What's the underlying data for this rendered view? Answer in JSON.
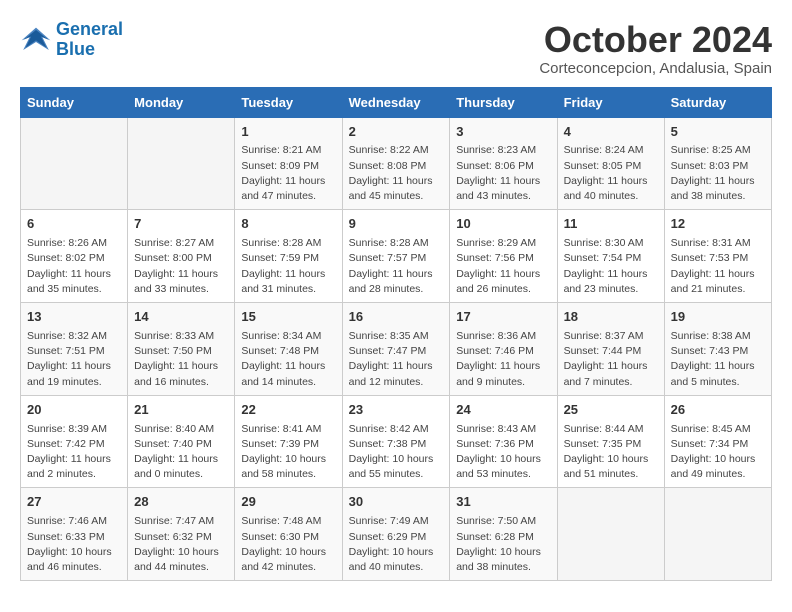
{
  "logo": {
    "line1": "General",
    "line2": "Blue"
  },
  "title": "October 2024",
  "location": "Corteconcepcion, Andalusia, Spain",
  "header_days": [
    "Sunday",
    "Monday",
    "Tuesday",
    "Wednesday",
    "Thursday",
    "Friday",
    "Saturday"
  ],
  "weeks": [
    [
      {
        "day": "",
        "info": ""
      },
      {
        "day": "",
        "info": ""
      },
      {
        "day": "1",
        "info": "Sunrise: 8:21 AM\nSunset: 8:09 PM\nDaylight: 11 hours and 47 minutes."
      },
      {
        "day": "2",
        "info": "Sunrise: 8:22 AM\nSunset: 8:08 PM\nDaylight: 11 hours and 45 minutes."
      },
      {
        "day": "3",
        "info": "Sunrise: 8:23 AM\nSunset: 8:06 PM\nDaylight: 11 hours and 43 minutes."
      },
      {
        "day": "4",
        "info": "Sunrise: 8:24 AM\nSunset: 8:05 PM\nDaylight: 11 hours and 40 minutes."
      },
      {
        "day": "5",
        "info": "Sunrise: 8:25 AM\nSunset: 8:03 PM\nDaylight: 11 hours and 38 minutes."
      }
    ],
    [
      {
        "day": "6",
        "info": "Sunrise: 8:26 AM\nSunset: 8:02 PM\nDaylight: 11 hours and 35 minutes."
      },
      {
        "day": "7",
        "info": "Sunrise: 8:27 AM\nSunset: 8:00 PM\nDaylight: 11 hours and 33 minutes."
      },
      {
        "day": "8",
        "info": "Sunrise: 8:28 AM\nSunset: 7:59 PM\nDaylight: 11 hours and 31 minutes."
      },
      {
        "day": "9",
        "info": "Sunrise: 8:28 AM\nSunset: 7:57 PM\nDaylight: 11 hours and 28 minutes."
      },
      {
        "day": "10",
        "info": "Sunrise: 8:29 AM\nSunset: 7:56 PM\nDaylight: 11 hours and 26 minutes."
      },
      {
        "day": "11",
        "info": "Sunrise: 8:30 AM\nSunset: 7:54 PM\nDaylight: 11 hours and 23 minutes."
      },
      {
        "day": "12",
        "info": "Sunrise: 8:31 AM\nSunset: 7:53 PM\nDaylight: 11 hours and 21 minutes."
      }
    ],
    [
      {
        "day": "13",
        "info": "Sunrise: 8:32 AM\nSunset: 7:51 PM\nDaylight: 11 hours and 19 minutes."
      },
      {
        "day": "14",
        "info": "Sunrise: 8:33 AM\nSunset: 7:50 PM\nDaylight: 11 hours and 16 minutes."
      },
      {
        "day": "15",
        "info": "Sunrise: 8:34 AM\nSunset: 7:48 PM\nDaylight: 11 hours and 14 minutes."
      },
      {
        "day": "16",
        "info": "Sunrise: 8:35 AM\nSunset: 7:47 PM\nDaylight: 11 hours and 12 minutes."
      },
      {
        "day": "17",
        "info": "Sunrise: 8:36 AM\nSunset: 7:46 PM\nDaylight: 11 hours and 9 minutes."
      },
      {
        "day": "18",
        "info": "Sunrise: 8:37 AM\nSunset: 7:44 PM\nDaylight: 11 hours and 7 minutes."
      },
      {
        "day": "19",
        "info": "Sunrise: 8:38 AM\nSunset: 7:43 PM\nDaylight: 11 hours and 5 minutes."
      }
    ],
    [
      {
        "day": "20",
        "info": "Sunrise: 8:39 AM\nSunset: 7:42 PM\nDaylight: 11 hours and 2 minutes."
      },
      {
        "day": "21",
        "info": "Sunrise: 8:40 AM\nSunset: 7:40 PM\nDaylight: 11 hours and 0 minutes."
      },
      {
        "day": "22",
        "info": "Sunrise: 8:41 AM\nSunset: 7:39 PM\nDaylight: 10 hours and 58 minutes."
      },
      {
        "day": "23",
        "info": "Sunrise: 8:42 AM\nSunset: 7:38 PM\nDaylight: 10 hours and 55 minutes."
      },
      {
        "day": "24",
        "info": "Sunrise: 8:43 AM\nSunset: 7:36 PM\nDaylight: 10 hours and 53 minutes."
      },
      {
        "day": "25",
        "info": "Sunrise: 8:44 AM\nSunset: 7:35 PM\nDaylight: 10 hours and 51 minutes."
      },
      {
        "day": "26",
        "info": "Sunrise: 8:45 AM\nSunset: 7:34 PM\nDaylight: 10 hours and 49 minutes."
      }
    ],
    [
      {
        "day": "27",
        "info": "Sunrise: 7:46 AM\nSunset: 6:33 PM\nDaylight: 10 hours and 46 minutes."
      },
      {
        "day": "28",
        "info": "Sunrise: 7:47 AM\nSunset: 6:32 PM\nDaylight: 10 hours and 44 minutes."
      },
      {
        "day": "29",
        "info": "Sunrise: 7:48 AM\nSunset: 6:30 PM\nDaylight: 10 hours and 42 minutes."
      },
      {
        "day": "30",
        "info": "Sunrise: 7:49 AM\nSunset: 6:29 PM\nDaylight: 10 hours and 40 minutes."
      },
      {
        "day": "31",
        "info": "Sunrise: 7:50 AM\nSunset: 6:28 PM\nDaylight: 10 hours and 38 minutes."
      },
      {
        "day": "",
        "info": ""
      },
      {
        "day": "",
        "info": ""
      }
    ]
  ]
}
